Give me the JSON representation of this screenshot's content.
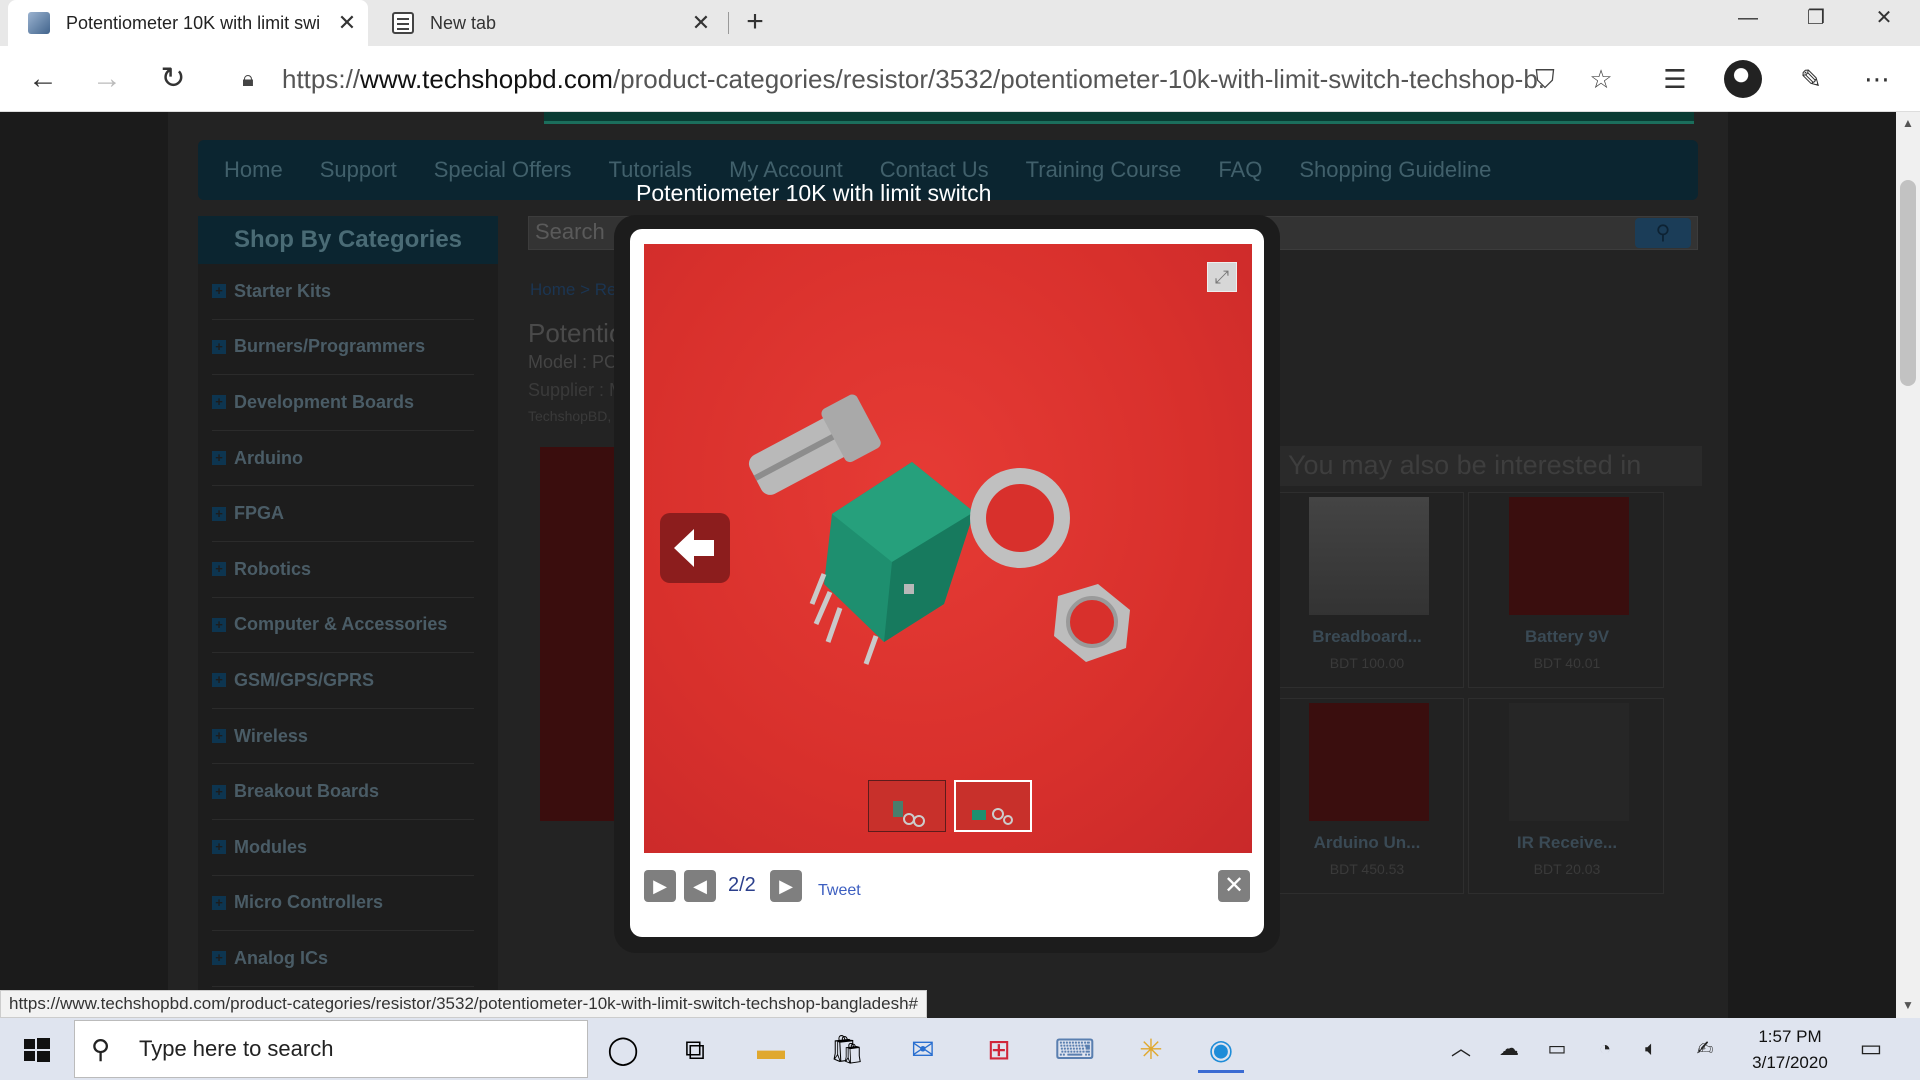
{
  "browser": {
    "tabs": [
      {
        "title": "Potentiometer 10K with limit swi"
      },
      {
        "title": "New tab"
      }
    ],
    "url_scheme": "https://",
    "url_domain": "www.techshopbd.com",
    "url_path": "/product-categories/resistor/3532/potentiometer-10k-with-limit-switch-techshop-b...",
    "status_url": "https://www.techshopbd.com/product-categories/resistor/3532/potentiometer-10k-with-limit-switch-techshop-bangladesh#"
  },
  "site": {
    "nav": [
      "Home",
      "Support",
      "Special Offers",
      "Tutorials",
      "My Account",
      "Contact Us",
      "Training Course",
      "FAQ",
      "Shopping Guideline"
    ],
    "categories_title": "Shop By Categories",
    "categories": [
      "Starter Kits",
      "Burners/Programmers",
      "Development Boards",
      "Arduino",
      "FPGA",
      "Robotics",
      "Computer & Accessories",
      "GSM/GPS/GPRS",
      "Wireless",
      "Breakout Boards",
      "Modules",
      "Micro Controllers",
      "Analog ICs"
    ],
    "search_label": "Search",
    "breadcrumb": "Home > Res",
    "product_title_partial": "Potentio",
    "model_partial": "Model : PCM",
    "supplier_partial": "Supplier : M",
    "brand_partial": "TechshopBD, E",
    "also_title": "You may also be interested in",
    "related": [
      {
        "name": "Breadboard...",
        "price": "BDT 100.00"
      },
      {
        "name": "Battery 9V",
        "price": "BDT 40.01"
      },
      {
        "name": "Arduino Un...",
        "price": "BDT 450.53"
      },
      {
        "name": "IR Receive...",
        "price": "BDT 20.03"
      }
    ]
  },
  "lightbox": {
    "title": "Potentiometer 10K with limit switch",
    "counter": "2/2",
    "tweet": "Tweet"
  },
  "taskbar": {
    "search_placeholder": "Type here to search",
    "time": "1:57 PM",
    "date": "3/17/2020"
  }
}
